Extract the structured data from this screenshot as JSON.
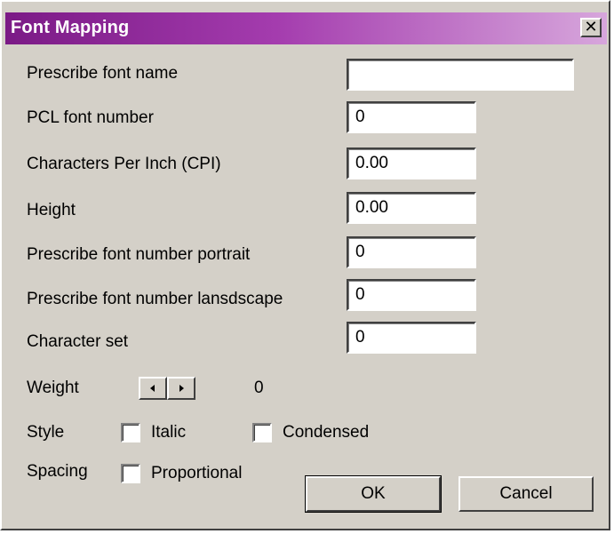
{
  "window": {
    "title": "Font Mapping",
    "close_glyph": "✕",
    "close_icon": "close-icon"
  },
  "colors": {
    "dialog_bg": "#d4d0c8",
    "title_start": "#7b1a86",
    "title_end": "#d7a6dc"
  },
  "fields": {
    "prescribe_font_name": {
      "label": "Prescribe font name",
      "value": ""
    },
    "pcl_font_number": {
      "label": "PCL font number",
      "value": "0"
    },
    "cpi": {
      "label": "Characters Per Inch (CPI)",
      "value": "0.00"
    },
    "height": {
      "label": "Height",
      "value": "0.00"
    },
    "font_number_portrait": {
      "label": "Prescribe font number portrait",
      "value": "0"
    },
    "font_number_landscape": {
      "label": "Prescribe font number lansdscape",
      "value": "0"
    },
    "character_set": {
      "label": "Character set",
      "value": "0"
    }
  },
  "weight": {
    "label": "Weight",
    "value": "0",
    "left_icon": "arrow-left-icon",
    "right_icon": "arrow-right-icon"
  },
  "style": {
    "label": "Style",
    "italic": {
      "label": "Italic",
      "checked": false
    },
    "condensed": {
      "label": "Condensed",
      "checked": false
    }
  },
  "spacing": {
    "label": "Spacing",
    "proportional": {
      "label": "Proportional",
      "checked": false
    }
  },
  "buttons": {
    "ok": "OK",
    "cancel": "Cancel"
  }
}
